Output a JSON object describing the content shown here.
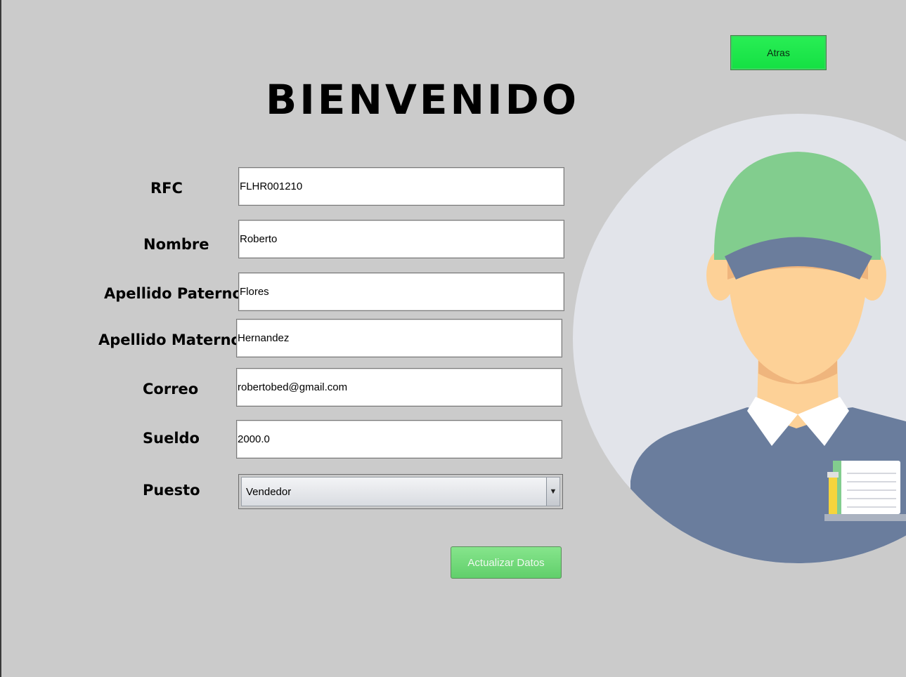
{
  "header": {
    "back_label": "Atras",
    "title": "BIENVENIDO"
  },
  "form": {
    "rfc": {
      "label": "RFC",
      "value": "FLHR001210"
    },
    "nombre": {
      "label": "Nombre",
      "value": "Roberto"
    },
    "apellido_paterno": {
      "label": "Apellido Paterno",
      "value": "Flores"
    },
    "apellido_materno": {
      "label": "Apellido Materno",
      "value": "Hernandez"
    },
    "correo": {
      "label": "Correo",
      "value": "robertobed@gmail.com"
    },
    "sueldo": {
      "label": "Sueldo",
      "value": "2000.0"
    },
    "puesto": {
      "label": "Puesto",
      "value": "Vendedor"
    }
  },
  "actions": {
    "update_label": "Actualizar Datos"
  },
  "avatar": {
    "icon": "worker-avatar-icon",
    "colors": {
      "circle": "#e2e4ea",
      "cap": "#82cd8e",
      "cap_brim": "#6b7d9c",
      "skin": "#fdd197",
      "shirt": "#6a7d9d",
      "collar": "#ffffff"
    }
  },
  "colors": {
    "background": "#cbcbcb",
    "back_button": "#1ce64a",
    "update_button": "#6fd878"
  }
}
